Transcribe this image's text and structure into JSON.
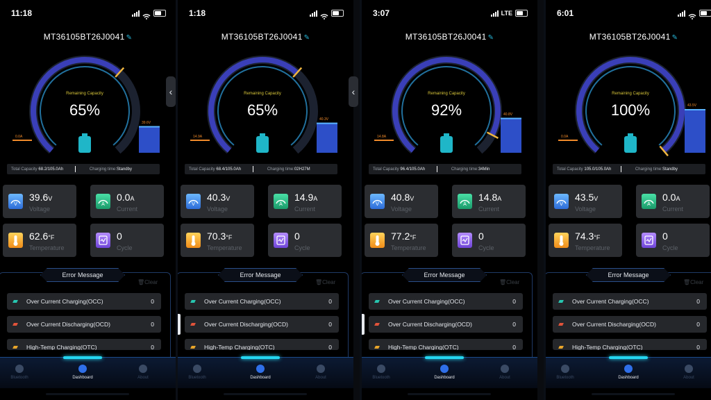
{
  "screens": [
    {
      "time": "11:18",
      "network": "",
      "device_id": "MT36105BT26J0041",
      "remaining_label": "Remaining Capacity",
      "percent": "65%",
      "capacity_fraction": 0.65,
      "low_label": "0.0A",
      "high_label": "39.6V",
      "high_level": 0.55,
      "total_capacity_label": "Total Capacity",
      "total_capacity": "68.2/105.0Ah",
      "charging_time_label": "Charging time:",
      "charging_time": "Standby",
      "voltage": "39.6",
      "voltage_unit": "V",
      "voltage_label": "Voltage",
      "current": "0.0",
      "current_unit": "A",
      "current_label": "Current",
      "temperature": "62.6",
      "temperature_unit": "°F",
      "temperature_label": "Temperature",
      "cycle": "0",
      "cycle_label": "Cycle"
    },
    {
      "time": "1:18",
      "network": "",
      "device_id": "MT36105BT26J0041",
      "remaining_label": "Remaining Capacity",
      "percent": "65%",
      "capacity_fraction": 0.65,
      "low_label": "14.9A",
      "high_label": "40.3V",
      "high_level": 0.62,
      "total_capacity_label": "Total Capacity",
      "total_capacity": "68.4/105.0Ah",
      "charging_time_label": "Charging time:",
      "charging_time": "02H27M",
      "voltage": "40.3",
      "voltage_unit": "V",
      "voltage_label": "Voltage",
      "current": "14.9",
      "current_unit": "A",
      "current_label": "Current",
      "temperature": "70.3",
      "temperature_unit": "°F",
      "temperature_label": "Temperature",
      "cycle": "0",
      "cycle_label": "Cycle"
    },
    {
      "time": "3:07",
      "network": "LTE",
      "device_id": "MT36105BT26J0041",
      "remaining_label": "Remaining Capacity",
      "percent": "92%",
      "capacity_fraction": 0.92,
      "low_label": "14.8A",
      "high_label": "40.8V",
      "high_level": 0.72,
      "total_capacity_label": "Total Capacity",
      "total_capacity": "96.4/105.0Ah",
      "charging_time_label": "Charging time:",
      "charging_time": "34Min",
      "voltage": "40.8",
      "voltage_unit": "V",
      "voltage_label": "Voltage",
      "current": "14.8",
      "current_unit": "A",
      "current_label": "Current",
      "temperature": "77.2",
      "temperature_unit": "°F",
      "temperature_label": "Temperature",
      "cycle": "0",
      "cycle_label": "Cycle"
    },
    {
      "time": "6:01",
      "network": "",
      "device_id": "MT36105BT26J0041",
      "remaining_label": "Remaining Capacity",
      "percent": "100%",
      "capacity_fraction": 1.0,
      "low_label": "0.0A",
      "high_label": "43.5V",
      "high_level": 0.9,
      "total_capacity_label": "Total Capacity",
      "total_capacity": "105.0/105.0Ah",
      "charging_time_label": "Charging time:",
      "charging_time": "Standby",
      "voltage": "43.5",
      "voltage_unit": "V",
      "voltage_label": "Voltage",
      "current": "0.0",
      "current_unit": "A",
      "current_label": "Current",
      "temperature": "74.3",
      "temperature_unit": "°F",
      "temperature_label": "Temperature",
      "cycle": "0",
      "cycle_label": "Cycle"
    }
  ],
  "error_section": {
    "title": "Error Message",
    "clear_label": "Clear",
    "rows": [
      {
        "name": "Over Current Charging(OCC)",
        "count": "0",
        "color": "#27c6b0"
      },
      {
        "name": "Over Current Discharging(OCD)",
        "count": "0",
        "color": "#e0533a"
      },
      {
        "name": "High-Temp Charging(OTC)",
        "count": "0",
        "color": "#e8a52a"
      }
    ]
  },
  "nav": {
    "bluetooth": "Bluetooth",
    "dashboard": "Dashboard",
    "about": "About"
  },
  "colors": {
    "accent": "#24d6f0",
    "gauge_arc": "#2f9fe0",
    "gauge_fill": "#3a3fb8",
    "needle": "#f0b640"
  },
  "icons": {
    "side_handle": "chevron-left-icon",
    "edit": "pencil-icon"
  }
}
